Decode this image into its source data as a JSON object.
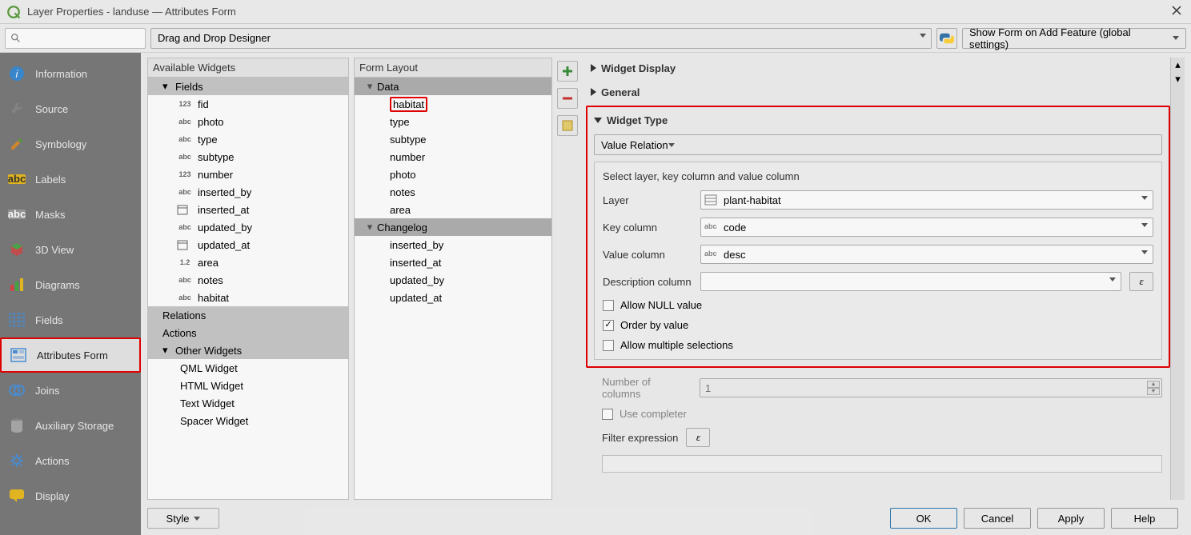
{
  "window": {
    "title": "Layer Properties - landuse — Attributes Form"
  },
  "top": {
    "designer": "Drag and Drop Designer",
    "show_form": "Show Form on Add Feature (global settings)"
  },
  "sidebar": {
    "items": [
      {
        "label": "Information"
      },
      {
        "label": "Source"
      },
      {
        "label": "Symbology"
      },
      {
        "label": "Labels"
      },
      {
        "label": "Masks"
      },
      {
        "label": "3D View"
      },
      {
        "label": "Diagrams"
      },
      {
        "label": "Fields"
      },
      {
        "label": "Attributes Form"
      },
      {
        "label": "Joins"
      },
      {
        "label": "Auxiliary Storage"
      },
      {
        "label": "Actions"
      },
      {
        "label": "Display"
      }
    ]
  },
  "available": {
    "title": "Available Widgets",
    "groups": {
      "fields": "Fields",
      "relations": "Relations",
      "actions": "Actions",
      "other": "Other Widgets"
    },
    "fields": [
      {
        "icon": "123",
        "name": "fid"
      },
      {
        "icon": "abc",
        "name": "photo"
      },
      {
        "icon": "abc",
        "name": "type"
      },
      {
        "icon": "abc",
        "name": "subtype"
      },
      {
        "icon": "123",
        "name": "number"
      },
      {
        "icon": "abc",
        "name": "inserted_by"
      },
      {
        "icon": "dt",
        "name": "inserted_at"
      },
      {
        "icon": "abc",
        "name": "updated_by"
      },
      {
        "icon": "dt",
        "name": "updated_at"
      },
      {
        "icon": "1.2",
        "name": "area"
      },
      {
        "icon": "abc",
        "name": "notes"
      },
      {
        "icon": "abc",
        "name": "habitat"
      }
    ],
    "other": [
      "QML Widget",
      "HTML Widget",
      "Text Widget",
      "Spacer Widget"
    ]
  },
  "layout": {
    "title": "Form Layout",
    "groups": [
      {
        "name": "Data",
        "items": [
          "habitat",
          "type",
          "subtype",
          "number",
          "photo",
          "notes",
          "area"
        ]
      },
      {
        "name": "Changelog",
        "items": [
          "inserted_by",
          "inserted_at",
          "updated_by",
          "updated_at"
        ]
      }
    ],
    "selected": "habitat"
  },
  "right": {
    "widget_display": "Widget Display",
    "general": "General",
    "widget_type": "Widget Type",
    "value_relation": "Value Relation",
    "help_text": "Select layer, key column and value column",
    "rows": {
      "layer_label": "Layer",
      "layer_value": "plant-habitat",
      "key_label": "Key column",
      "key_value": "code",
      "value_label": "Value column",
      "value_value": "desc",
      "desc_label": "Description column",
      "desc_value": ""
    },
    "checks": {
      "allow_null": "Allow NULL value",
      "order_by": "Order by value",
      "allow_multi": "Allow multiple selections"
    },
    "numcols_label": "Number of columns",
    "numcols_value": "1",
    "use_completer": "Use completer",
    "filter_label": "Filter expression"
  },
  "footer": {
    "style": "Style",
    "ok": "OK",
    "cancel": "Cancel",
    "apply": "Apply",
    "help": "Help"
  }
}
